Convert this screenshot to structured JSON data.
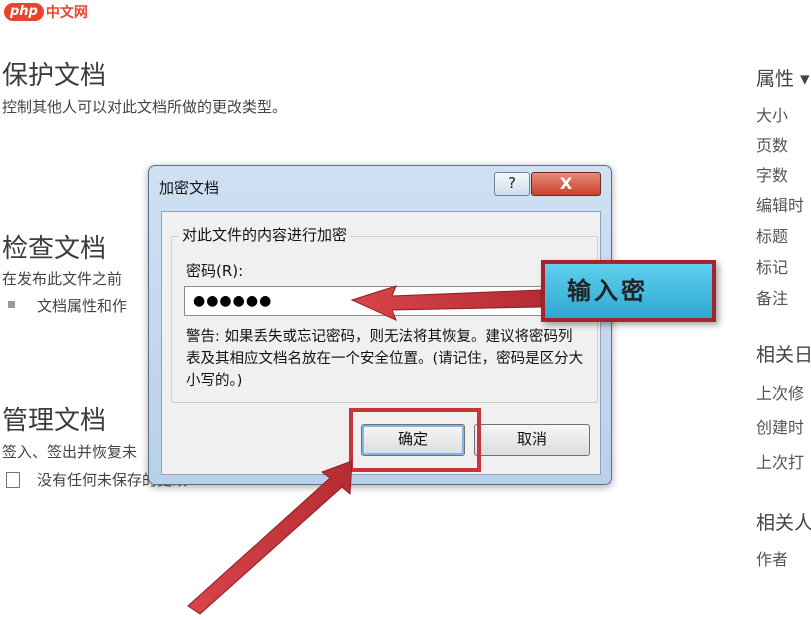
{
  "watermark": {
    "badge": "php",
    "text": "中文网"
  },
  "sections": {
    "protect": {
      "title": "保护文档",
      "desc": "控制其他人可以对此文档所做的更改类型。"
    },
    "inspect": {
      "title": "检查文档",
      "desc": "在发布此文件之前",
      "item": "文档属性和作"
    },
    "manage": {
      "title": "管理文档",
      "desc": "签入、签出并恢复未",
      "item": "没有任何未保存的更改"
    }
  },
  "properties": {
    "header": "属性",
    "items": [
      "大小",
      "页数",
      "字数",
      "编辑时",
      "标题",
      "标记",
      "备注"
    ],
    "dates_header": "相关日",
    "dates": [
      "上次修",
      "创建时",
      "上次打"
    ],
    "people_header": "相关人",
    "people": [
      "作者"
    ]
  },
  "dialog": {
    "title": "加密文档",
    "help_label": "?",
    "close_label": "X",
    "group_label": "对此文件的内容进行加密",
    "password_label": "密码(R):",
    "password_value": "●●●●●●",
    "warning": "警告: 如果丢失或忘记密码，则无法将其恢复。建议将密码列表及其相应文档名放在一个安全位置。(请记住，密码是区分大小写的。)",
    "ok_label": "确定",
    "cancel_label": "取消"
  },
  "annotation": {
    "callout_text": "输入密",
    "color": "#c8343c"
  }
}
